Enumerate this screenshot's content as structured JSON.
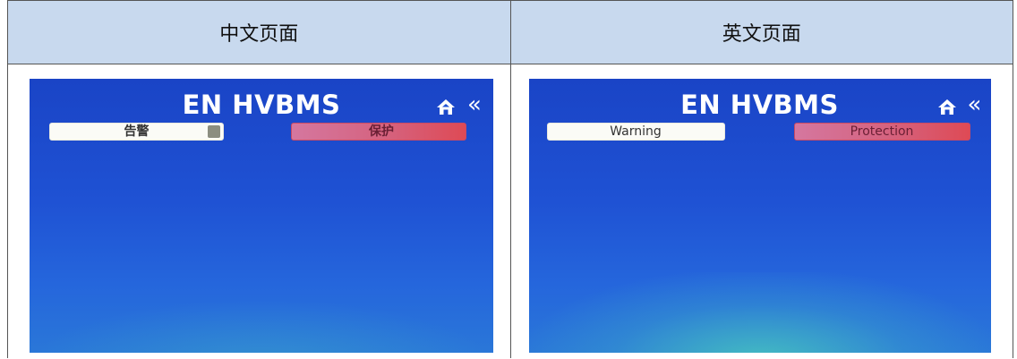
{
  "table": {
    "headers": [
      "中文页面",
      "英文页面"
    ]
  },
  "cn_screen": {
    "title": "EN HVBMS",
    "home_icon": "home-icon",
    "back_icon": "double-chevron-left-icon",
    "back_glyph": "«",
    "warning_label": "告警",
    "protection_label": "保护"
  },
  "en_screen": {
    "title": "EN HVBMS",
    "home_icon": "home-icon",
    "back_icon": "double-chevron-left-icon",
    "back_glyph": "«",
    "warning_label": "Warning",
    "protection_label": "Protection"
  },
  "colors": {
    "header_bg": "#c8d9ee",
    "screen_blue": "#1f52d4",
    "protection_red": "#d5627e",
    "warning_white": "#fbfbf6"
  }
}
